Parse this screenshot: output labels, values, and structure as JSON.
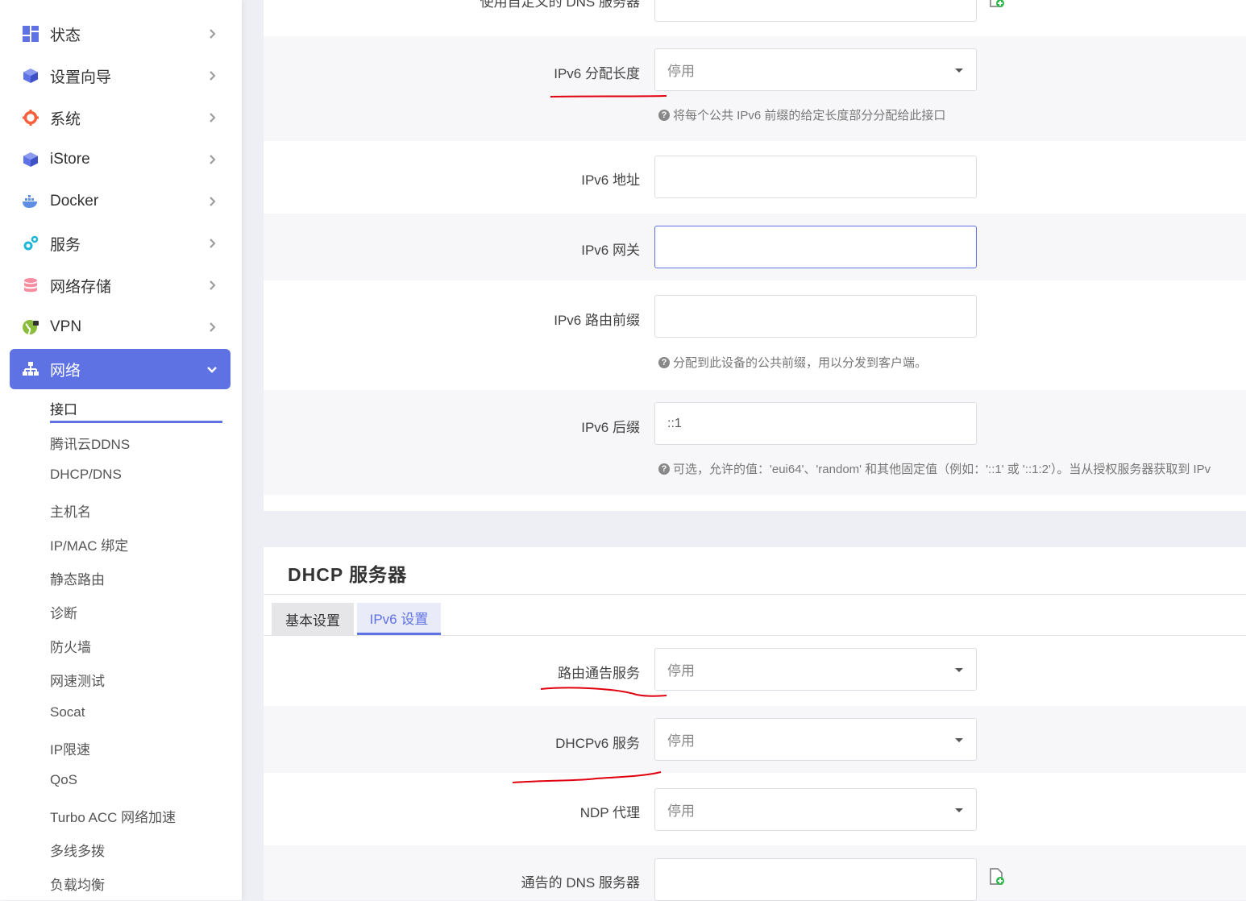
{
  "sidebar": {
    "menu": [
      {
        "label": "状态",
        "icon": "dashboard-icon"
      },
      {
        "label": "设置向导",
        "icon": "cube-icon"
      },
      {
        "label": "系统",
        "icon": "gear-icon"
      },
      {
        "label": "iStore",
        "icon": "cube-icon"
      },
      {
        "label": "Docker",
        "icon": "docker-icon"
      },
      {
        "label": "服务",
        "icon": "gears-icon"
      },
      {
        "label": "网络存储",
        "icon": "database-icon"
      },
      {
        "label": "VPN",
        "icon": "globe-lock-icon"
      },
      {
        "label": "网络",
        "icon": "sitemap-icon"
      }
    ],
    "submenu": [
      "接口",
      "腾讯云DDNS",
      "DHCP/DNS",
      "主机名",
      "IP/MAC 绑定",
      "静态路由",
      "诊断",
      "防火墙",
      "网速测试",
      "Socat",
      "IP限速",
      "QoS",
      "Turbo ACC 网络加速",
      "多线多拨",
      "负载均衡"
    ]
  },
  "form_top": {
    "custom_dns_label": "使用自定义的 DNS 服务器",
    "ipv6_assign_label": "IPv6 分配长度",
    "ipv6_assign_value": "停用",
    "ipv6_assign_hint": "将每个公共 IPv6 前缀的给定长度部分分配给此接口",
    "ipv6_addr_label": "IPv6 地址",
    "ipv6_gw_label": "IPv6 网关",
    "ipv6_prefix_label": "IPv6 路由前缀",
    "ipv6_prefix_hint": "分配到此设备的公共前缀，用以分发到客户端。",
    "ipv6_suffix_label": "IPv6 后缀",
    "ipv6_suffix_value": "::1",
    "ipv6_suffix_hint": "可选，允许的值：'eui64'、'random' 和其他固定值（例如：'::1' 或 '::1:2'）。当从授权服务器获取到 IPv"
  },
  "dhcp": {
    "title": "DHCP 服务器",
    "tabs": [
      "基本设置",
      "IPv6 设置"
    ],
    "ra_label": "路由通告服务",
    "ra_value": "停用",
    "dhcpv6_label": "DHCPv6 服务",
    "dhcpv6_value": "停用",
    "ndp_label": "NDP 代理",
    "ndp_value": "停用",
    "dns_label": "通告的 DNS 服务器"
  },
  "colors": {
    "accent": "#5e72e4",
    "annotation": "#e0000f"
  }
}
